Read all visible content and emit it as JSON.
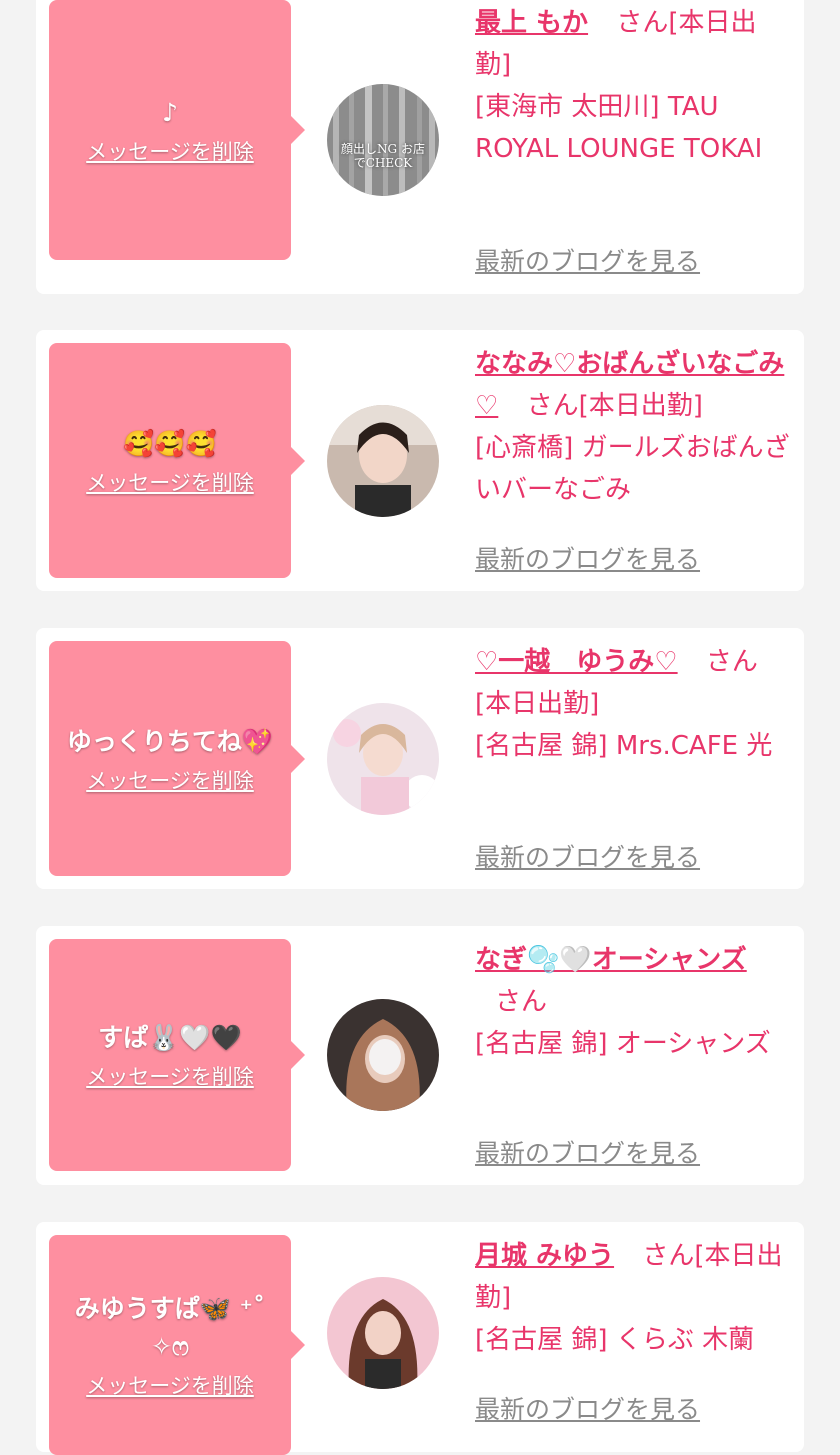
{
  "delete_label": "メッセージを削除",
  "blog_label": "最新のブログを見る",
  "items": [
    {
      "message": "♪",
      "name": "最上 もか",
      "honorific": "さん",
      "status": "[本日出勤]",
      "location": "[東海市 太田川]",
      "shop": "TAU ROYAL LOUNGE TOKAI",
      "avatar_overlay": "顔出しNG お店でCHECK"
    },
    {
      "message": "🥰🥰🥰",
      "name": "ななみ♡おばんざいなごみ♡",
      "honorific": "さん",
      "status": "[本日出勤]",
      "location": "[心斎橋]",
      "shop": "ガールズおばんざいバーなごみ"
    },
    {
      "message": "ゆっくりちてね💖",
      "name": "♡一越　ゆうみ♡",
      "honorific": "さん",
      "status": "[本日出勤]",
      "location": "[名古屋 錦]",
      "shop": "Mrs.CAFE 光"
    },
    {
      "message": "すぱ🐰🤍🖤",
      "name": "なぎ🫧🤍オーシャンズ",
      "honorific": "さん",
      "status": "",
      "location": "[名古屋 錦]",
      "shop": "オーシャンズ"
    },
    {
      "message": "みゆうすぱ🦋 ⁺˚✧ෆ",
      "name": "月城 みゆう",
      "honorific": "さん",
      "status": "[本日出勤]",
      "location": "[名古屋 錦]",
      "shop": "くらぶ 木蘭"
    }
  ]
}
